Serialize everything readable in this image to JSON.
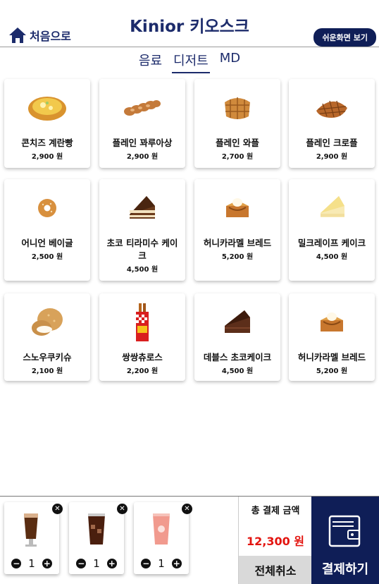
{
  "header": {
    "home_label": "처음으로",
    "title": "Kinior 키오스크",
    "easy_view_label": "쉬운화면 보기"
  },
  "tabs": [
    {
      "label": "음료"
    },
    {
      "label": "디저트"
    },
    {
      "label": "MD"
    }
  ],
  "products": [
    {
      "name": "콘치즈 계란빵",
      "price": "2,900 원",
      "icon": "bread-icon"
    },
    {
      "name": "플레인 꽈루아상",
      "price": "2,900 원",
      "icon": "twist-pastry-icon"
    },
    {
      "name": "플레인 와플",
      "price": "2,700 원",
      "icon": "waffle-icon"
    },
    {
      "name": "플레인 크로플",
      "price": "2,900 원",
      "icon": "croffle-icon"
    },
    {
      "name": "어니언 베이글",
      "price": "2,500 원",
      "icon": "bagel-icon"
    },
    {
      "name": "초코 티라미수 케이크",
      "price": "4,500 원",
      "icon": "tiramisu-cake-icon"
    },
    {
      "name": "허니카라멜 브레드",
      "price": "5,200 원",
      "icon": "honey-bread-icon"
    },
    {
      "name": "밀크레이프 케이크",
      "price": "4,500 원",
      "icon": "crepe-cake-icon"
    },
    {
      "name": "스노우쿠키슈",
      "price": "2,100 원",
      "icon": "cream-puff-icon"
    },
    {
      "name": "쌍쌍츄로스",
      "price": "2,200 원",
      "icon": "churros-icon"
    },
    {
      "name": "데블스 초코케이크",
      "price": "4,500 원",
      "icon": "chocolate-cake-icon"
    },
    {
      "name": "허니카라멜 브레드",
      "price": "5,200 원",
      "icon": "honey-bread-icon"
    }
  ],
  "cart": {
    "items": [
      {
        "qty": "1",
        "icon": "dark-beverage-glass-icon"
      },
      {
        "qty": "1",
        "icon": "iced-coffee-icon"
      },
      {
        "qty": "1",
        "icon": "pink-smoothie-icon"
      }
    ],
    "remove_symbol": "✕",
    "minus_symbol": "−",
    "plus_symbol": "+"
  },
  "summary": {
    "total_label": "총 결제 금액",
    "total_value": "12,300 원",
    "cancel_all_label": "전체취소",
    "pay_label": "결제하기"
  },
  "colors": {
    "brand_navy": "#0f1e57",
    "title_navy": "#1c2b6b",
    "total_red": "#e3140f",
    "cancel_gray": "#d9d9d9"
  }
}
